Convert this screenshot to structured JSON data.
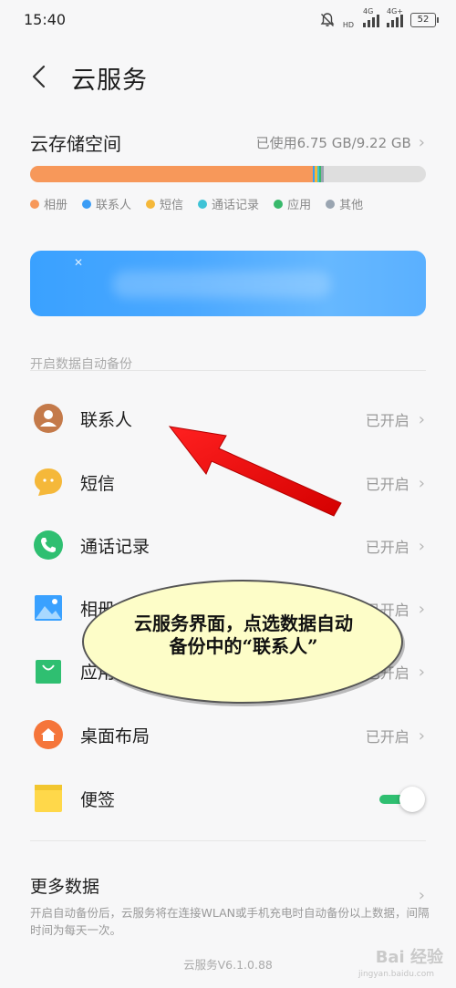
{
  "status_bar": {
    "time": "15:40",
    "network_1": "4G",
    "hd": "HD",
    "network_2": "4G+",
    "battery": "52"
  },
  "header": {
    "title": "云服务"
  },
  "storage": {
    "title": "云存储空间",
    "used_text": "已使用6.75 GB/9.22 GB",
    "segments": [
      {
        "category": "相册",
        "fraction": 0.715,
        "color": "#f7985a"
      },
      {
        "category": "联系人",
        "fraction": 0.005,
        "color": "#3a9cf5"
      },
      {
        "category": "短信",
        "fraction": 0.006,
        "color": "#f5b83a"
      },
      {
        "category": "通话记录",
        "fraction": 0.005,
        "color": "#3fc3d6"
      },
      {
        "category": "应用",
        "fraction": 0.004,
        "color": "#38b96b"
      },
      {
        "category": "其他",
        "fraction": 0.006,
        "color": "#9aa5b1"
      }
    ],
    "legend": [
      {
        "label": "相册",
        "color": "#f7985a"
      },
      {
        "label": "联系人",
        "color": "#3a9cf5"
      },
      {
        "label": "短信",
        "color": "#f5b83a"
      },
      {
        "label": "通话记录",
        "color": "#3fc3d6"
      },
      {
        "label": "应用",
        "color": "#38b96b"
      },
      {
        "label": "其他",
        "color": "#9aa5b1"
      }
    ]
  },
  "backup": {
    "section_label": "开启数据自动备份",
    "items": [
      {
        "label": "联系人",
        "status": "已开启",
        "icon": "contact-icon",
        "color": "#c47a4a"
      },
      {
        "label": "短信",
        "status": "已开启",
        "icon": "message-icon",
        "color": "#f5b83a"
      },
      {
        "label": "通话记录",
        "status": "已开启",
        "icon": "phone-icon",
        "color": "#2fbf71"
      },
      {
        "label": "相册",
        "status": "已开启",
        "icon": "photo-icon",
        "color": "#3aa1ff"
      },
      {
        "label": "应用",
        "status": "已开启",
        "icon": "app-bag-icon",
        "color": "#2fbf71"
      },
      {
        "label": "桌面布局",
        "status": "已开启",
        "icon": "home-icon",
        "color": "#f5753a"
      },
      {
        "label": "便签",
        "status": "",
        "icon": "note-icon",
        "color": "#ffd84a",
        "toggle": true
      }
    ]
  },
  "more_data": {
    "title": "更多数据",
    "description": "开启自动备份后，云服务将在连接WLAN或手机充电时自动备份以上数据，间隔时间为每天一次。"
  },
  "version": "云服务V6.1.0.88",
  "annotation": {
    "text": "云服务界面，点选数据自动备份中的“联系人”"
  },
  "watermark": {
    "text": "Bai 经验",
    "sub": "jingyan.baidu.com"
  }
}
